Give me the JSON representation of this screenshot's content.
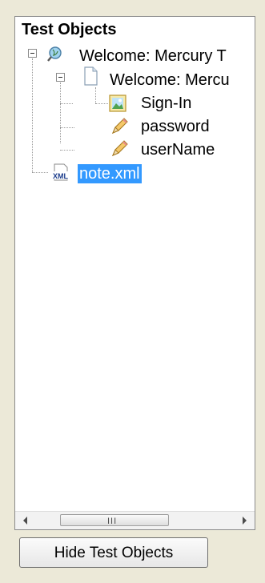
{
  "tree": {
    "title": "Test Objects",
    "nodes": [
      {
        "label": "Welcome: Mercury T",
        "icon": "browser-icon",
        "expanded": true
      },
      {
        "label": "Welcome: Mercu",
        "icon": "page-icon",
        "expanded": true
      },
      {
        "label": "Sign-In",
        "icon": "image-icon"
      },
      {
        "label": "password",
        "icon": "edit-field-icon"
      },
      {
        "label": "userName",
        "icon": "edit-field-icon"
      },
      {
        "label": "note.xml",
        "icon": "xml-file-icon",
        "selected": true
      }
    ]
  },
  "scrollbar": {
    "grip": "III"
  },
  "buttons": {
    "hide_label": "Hide Test Objects"
  },
  "colors": {
    "selection": "#3399ff",
    "background": "#ece9d8"
  }
}
